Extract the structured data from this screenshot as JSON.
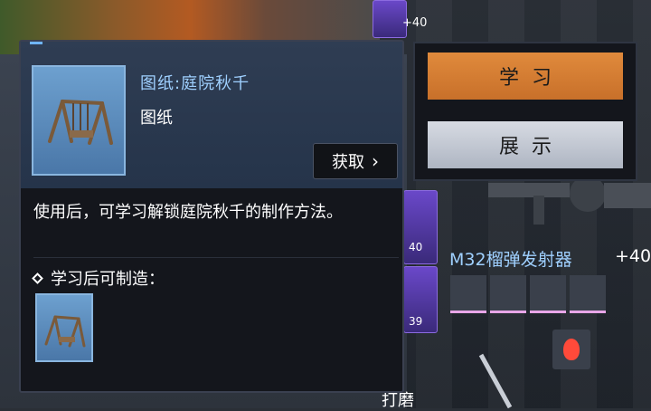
{
  "tooltip": {
    "title": "图纸:庭院秋千",
    "type": "图纸",
    "get_label": "获取",
    "description": "使用后，可学习解锁庭院秋千的制作方法。",
    "craft_section_label": "学习后可制造："
  },
  "actions": {
    "learn_label": "学习",
    "show_label": "展示"
  },
  "weapon": {
    "name": "M32榴弹发射器",
    "level": "+40"
  },
  "background": {
    "top_counter": "+40",
    "mid_counter": "40",
    "mid_counter_2": "39",
    "bottom_label": "打磨"
  },
  "colors": {
    "accent_blue": "#9fd0ff",
    "learn_orange": "#e08a3c",
    "show_gray": "#c6ccd6"
  }
}
